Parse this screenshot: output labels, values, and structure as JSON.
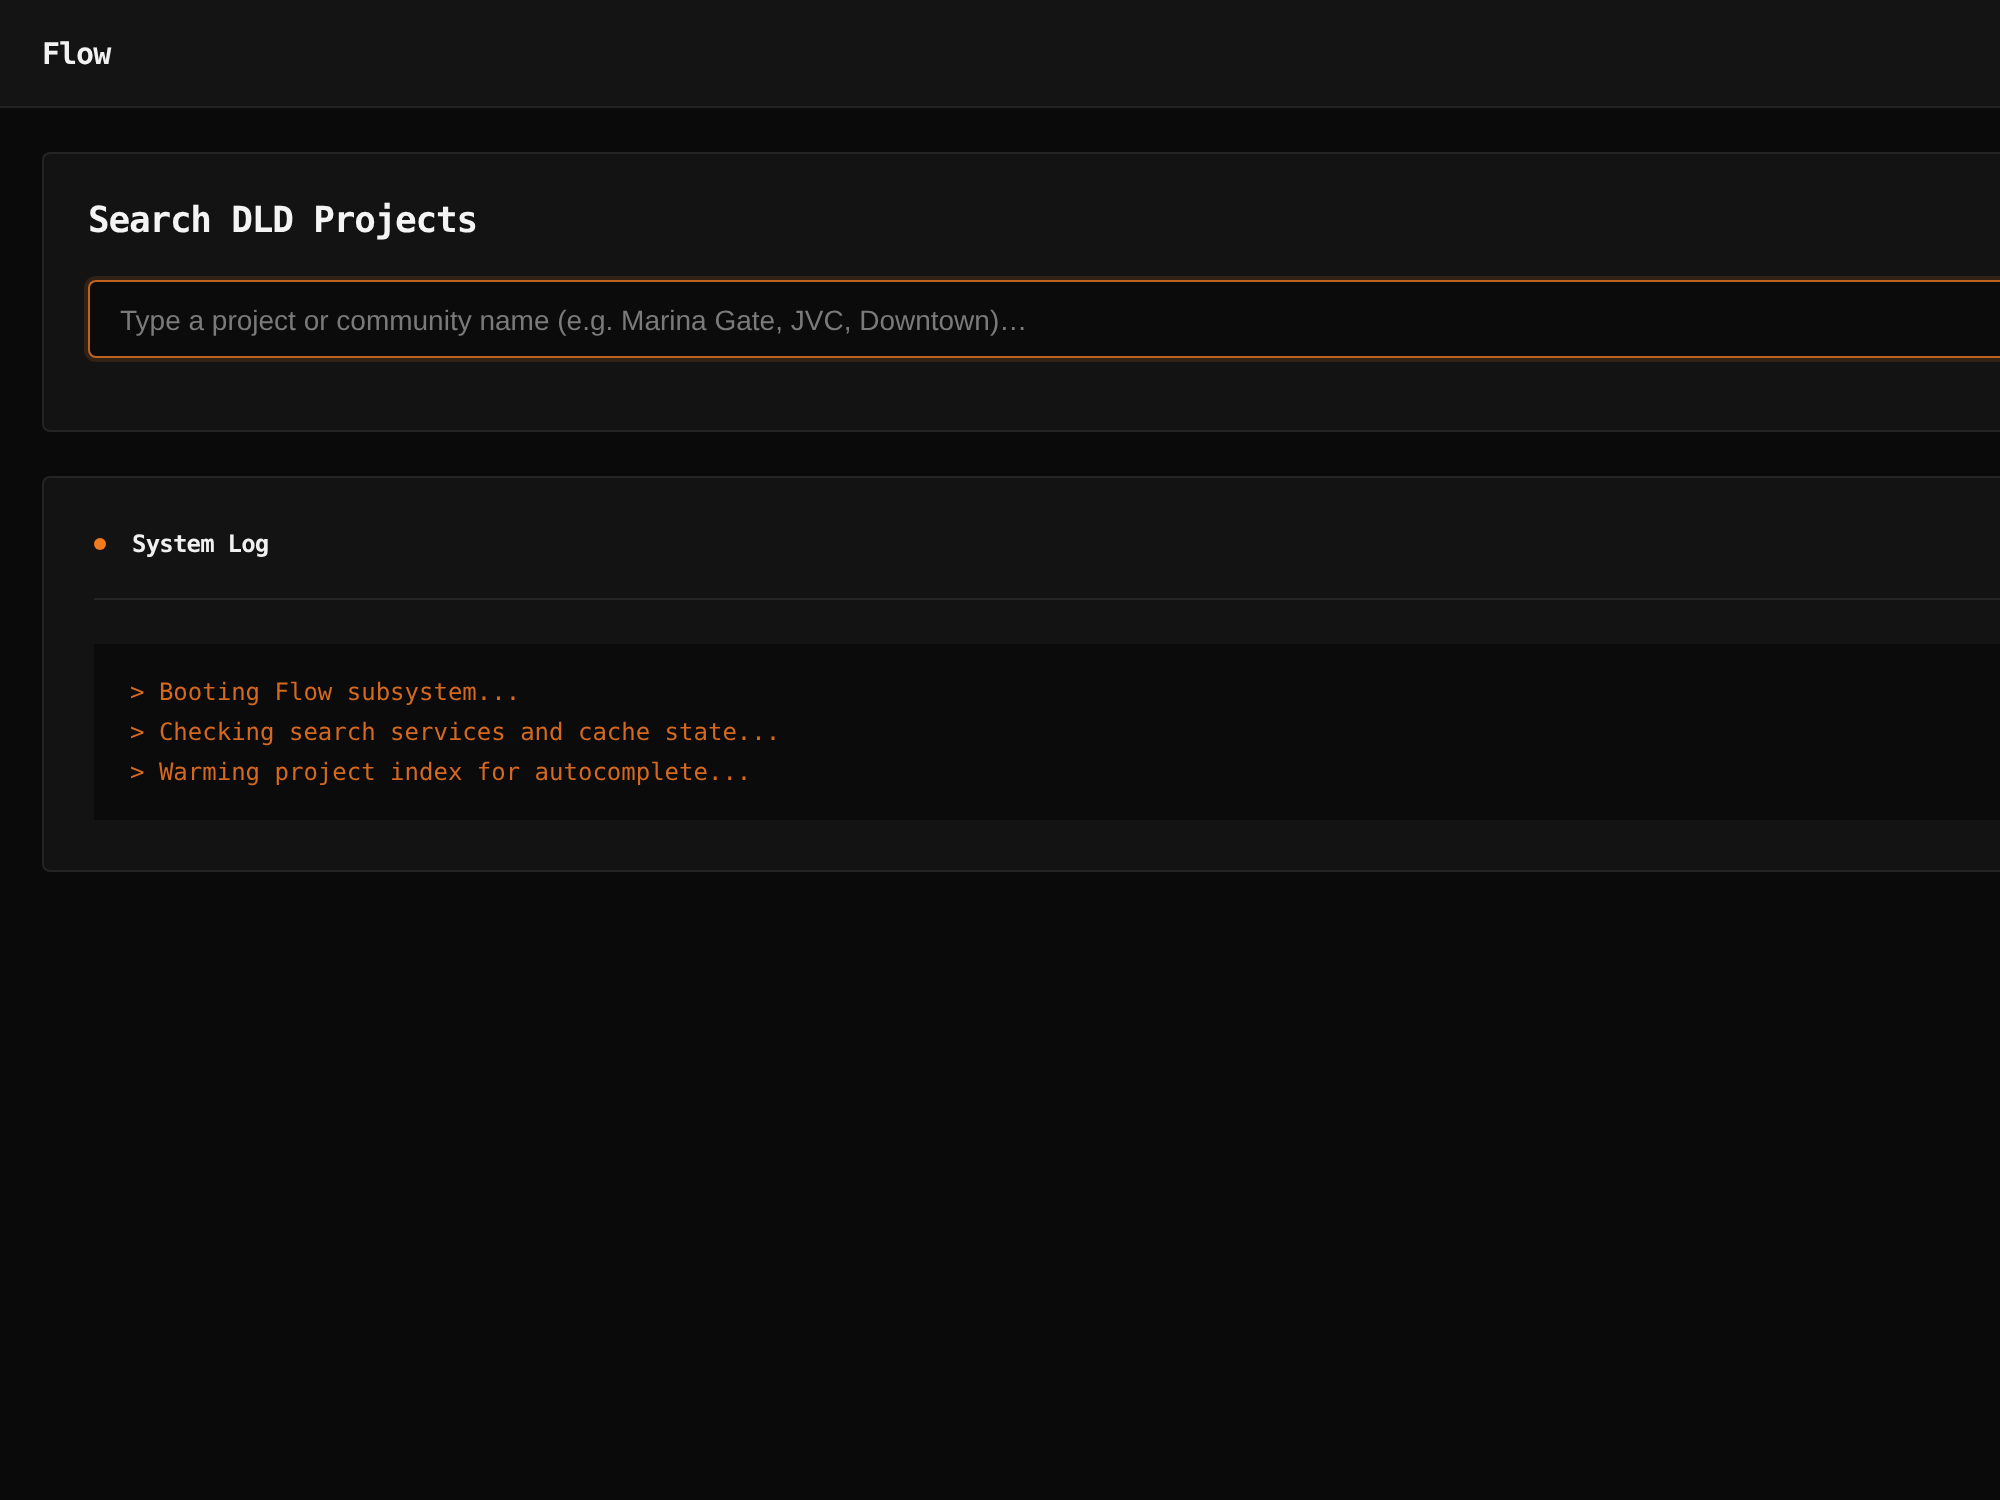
{
  "header": {
    "title": "Flow"
  },
  "search_card": {
    "title": "Search DLD Projects",
    "search": {
      "placeholder": "Type a project or community name (e.g. Marina Gate, JVC, Downtown)…"
    }
  },
  "log_card": {
    "title": "System Log",
    "lines": [
      "> Booting Flow subsystem...",
      "> Checking search services and cache state...",
      "> Warming project index for autocomplete..."
    ]
  }
}
